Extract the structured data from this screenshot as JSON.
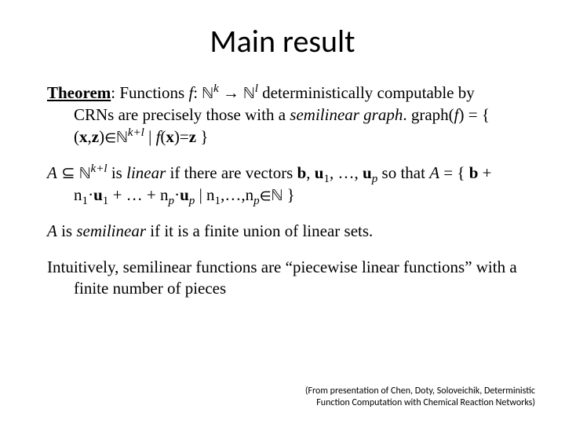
{
  "title": "Main result",
  "theorem": {
    "label": "Theorem",
    "t1a": ": Functions ",
    "f": "f",
    "t1b": ": ",
    "Nk_N": "ℕ",
    "Nk_k": "k",
    "arrow": " → ",
    "Nl_N": "ℕ",
    "Nl_l": "l",
    "t1c": " deterministically computable by CRNs are precisely those with a ",
    "semigraph": "semilinear graph",
    "t1d": ". graph(",
    "f2": "f",
    "t1e": ") = { (",
    "x": "x",
    "comma": ",",
    "z": "z",
    "t1f": ")",
    "elem": "∈",
    "Nkl_N": "ℕ",
    "Nkl_kl": "k+l",
    "bar": " | ",
    "f3": "f",
    "t1g": "(",
    "x2": "x",
    "t1h": ")=",
    "z2": "z",
    "t1i": " }"
  },
  "linear": {
    "A": "A",
    "sub": " ⊆ ",
    "N": "ℕ",
    "kl": "k+l",
    "t1": " is ",
    "word": "linear",
    "t2": " if there are vectors ",
    "b": "b",
    "t3": ", ",
    "u1": "u",
    "u1sub": "1",
    "t4": ", …, ",
    "up": "u",
    "upsub": "p",
    "t5": " so that ",
    "A2": "A",
    "eq": " = { ",
    "b2": "b",
    "plus1": " + n",
    "n1sub": "1",
    "dot1": "·",
    "u1b": "u",
    "u1bsub": "1",
    "plus2": " + … + n",
    "npsub": "p",
    "dot2": "·",
    "upb": "u",
    "upbsub": "p",
    "bar": " | n",
    "n1sub2": "1",
    "t6": ",…,n",
    "npsub2": "p",
    "elem": "∈",
    "N2": "ℕ",
    "t7": " }"
  },
  "semi": {
    "A": "A",
    "t1": " is ",
    "word": "semilinear",
    "t2": " if it is a finite union of linear sets."
  },
  "intuit": "Intuitively, semilinear functions are “piecewise linear functions” with a finite number of pieces",
  "credit": {
    "l1": "(From presentation of Chen, Doty, Soloveichik, Deterministic",
    "l2": "Function Computation with Chemical Reaction Networks)"
  }
}
